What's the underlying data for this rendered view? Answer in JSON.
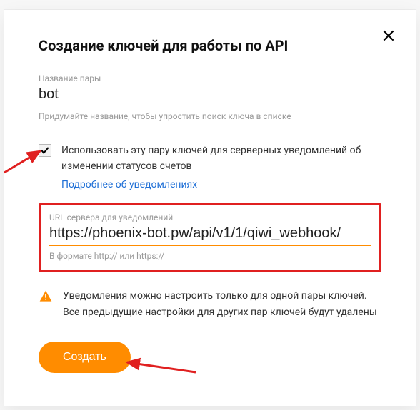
{
  "modal": {
    "title": "Создание ключей для работы по API",
    "nameField": {
      "label": "Название пары",
      "value": "bot",
      "hint": "Придумайте название, чтобы упростить поиск ключа в списке"
    },
    "checkbox": {
      "checked": true,
      "text": "Использовать эту пару ключей для серверных уведомлений об изменении статусов счетов",
      "link": "Подробнее об уведомлениях"
    },
    "urlField": {
      "label": "URL сервера для уведомлений",
      "value": "https://phoenix-bot.pw/api/v1/1/qiwi_webhook/",
      "hint": "В формате http:// или https://"
    },
    "warning": "Уведомления можно настроить только для одной пары ключей. Все предыдущие настройки для других пар ключей будут удалены",
    "createButton": "Создать"
  }
}
